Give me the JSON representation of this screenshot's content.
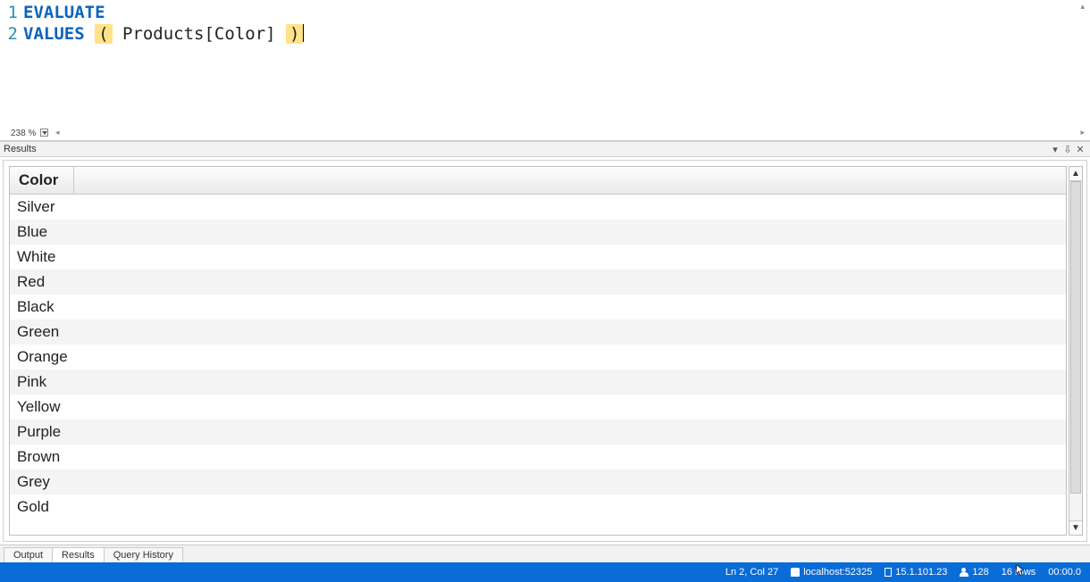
{
  "editor": {
    "lines": [
      {
        "num": "1",
        "tokens": [
          {
            "t": "EVALUATE",
            "c": "kw"
          }
        ]
      },
      {
        "num": "2",
        "tokens": [
          {
            "t": "VALUES",
            "c": "kw"
          },
          {
            "t": " "
          },
          {
            "t": "(",
            "c": "paren"
          },
          {
            "t": " Products[Color] ",
            "c": "ident"
          },
          {
            "t": ")",
            "c": "paren"
          }
        ]
      }
    ],
    "zoom": "238 %",
    "hscroll_left_glyph": "◂",
    "hscroll_right_glyph": "▸",
    "vscroll_top_glyph": "▴"
  },
  "results_panel": {
    "title": "Results",
    "menu_glyph": "▾",
    "pin_glyph": "⇩",
    "close_glyph": "✕"
  },
  "grid": {
    "column_header": "Color",
    "rows": [
      "Silver",
      "Blue",
      "White",
      "Red",
      "Black",
      "Green",
      "Orange",
      "Pink",
      "Yellow",
      "Purple",
      "Brown",
      "Grey",
      "Gold"
    ],
    "scroll_up_glyph": "▲",
    "scroll_down_glyph": "▼"
  },
  "tabs": {
    "items": [
      "Output",
      "Results",
      "Query History"
    ],
    "active_index": 1
  },
  "status": {
    "ln_col": "Ln 2, Col 27",
    "server": "localhost:52325",
    "version": "15.1.101.23",
    "spid": "128",
    "rows": "16 rows",
    "elapsed": "00:00.0"
  }
}
